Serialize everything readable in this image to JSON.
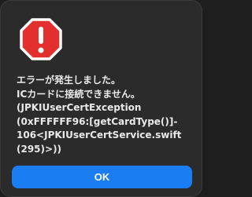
{
  "dialog": {
    "icon": "error-stop-icon",
    "icon_color": "#e3302f",
    "message_lines": [
      "エラーが発生しました。",
      "ICカードに接続できません。",
      "(JPKIUserCertException",
      "(0xFFFFFF96:[getCardType()]-",
      "106<JPKIUserCertService.swift",
      "(295)>))"
    ],
    "ok_label": "OK",
    "button_color": "#1a7df2"
  }
}
